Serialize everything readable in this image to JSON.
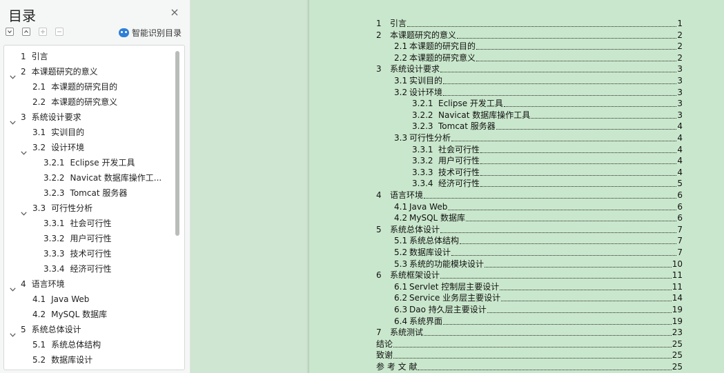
{
  "nav": {
    "title": "目录",
    "close_glyph": "×",
    "smart_toc_label": "智能识别目录",
    "tools": [
      "collapse-all-icon",
      "expand-all-icon",
      "add-heading-icon",
      "remove-heading-icon"
    ],
    "items": [
      {
        "num": "1",
        "title": "引言",
        "level": 0,
        "chevron": "none"
      },
      {
        "num": "2",
        "title": "本课题研究的意义",
        "level": 0,
        "chevron": "down"
      },
      {
        "num": "2.1",
        "title": "本课题的研究目的",
        "level": 1,
        "chevron": "none"
      },
      {
        "num": "2.2",
        "title": "本课题的研究意义",
        "level": 1,
        "chevron": "none"
      },
      {
        "num": "3",
        "title": "系统设计要求",
        "level": 0,
        "chevron": "down"
      },
      {
        "num": "3.1",
        "title": "实训目的",
        "level": 1,
        "chevron": "none"
      },
      {
        "num": "3.2",
        "title": "设计环境",
        "level": 1,
        "chevron": "down"
      },
      {
        "num": "3.2.1",
        "title": "Eclipse 开发工具",
        "level": 2,
        "chevron": "none"
      },
      {
        "num": "3.2.2",
        "title": "Navicat 数据库操作工...",
        "level": 2,
        "chevron": "none"
      },
      {
        "num": "3.2.3",
        "title": "Tomcat 服务器",
        "level": 2,
        "chevron": "none"
      },
      {
        "num": "3.3",
        "title": "可行性分析",
        "level": 1,
        "chevron": "down"
      },
      {
        "num": "3.3.1",
        "title": "社会可行性",
        "level": 2,
        "chevron": "none"
      },
      {
        "num": "3.3.2",
        "title": "用户可行性",
        "level": 2,
        "chevron": "none"
      },
      {
        "num": "3.3.3",
        "title": "技术可行性",
        "level": 2,
        "chevron": "none"
      },
      {
        "num": "3.3.4",
        "title": "经济可行性",
        "level": 2,
        "chevron": "none"
      },
      {
        "num": "4",
        "title": "语言环境",
        "level": 0,
        "chevron": "down"
      },
      {
        "num": "4.1",
        "title": "Java Web",
        "level": 1,
        "chevron": "none"
      },
      {
        "num": "4.2",
        "title": "MySQL 数据库",
        "level": 1,
        "chevron": "none"
      },
      {
        "num": "5",
        "title": "系统总体设计",
        "level": 0,
        "chevron": "down"
      },
      {
        "num": "5.1",
        "title": "系统总体结构",
        "level": 1,
        "chevron": "none"
      },
      {
        "num": "5.2",
        "title": "数据库设计",
        "level": 1,
        "chevron": "none"
      }
    ]
  },
  "document": {
    "toc": [
      {
        "num": "1",
        "title": "引言",
        "page": "1",
        "level": 0
      },
      {
        "num": "2",
        "title": "本课题研究的意义",
        "page": "2",
        "level": 0
      },
      {
        "num": "2.1",
        "title": "本课题的研究目的",
        "page": "2",
        "level": 1
      },
      {
        "num": "2.2",
        "title": "本课题的研究意义",
        "page": "2",
        "level": 1
      },
      {
        "num": "3",
        "title": "系统设计要求",
        "page": "3",
        "level": 0
      },
      {
        "num": "3.1",
        "title": "实训目的",
        "page": "3",
        "level": 1
      },
      {
        "num": "3.2",
        "title": "设计环境",
        "page": "3",
        "level": 1
      },
      {
        "num": "3.2.1",
        "title": "Eclipse 开发工具",
        "page": "3",
        "level": 2
      },
      {
        "num": "3.2.2",
        "title": "Navicat 数据库操作工具",
        "page": "3",
        "level": 2
      },
      {
        "num": "3.2.3",
        "title": "Tomcat 服务器",
        "page": "4",
        "level": 2
      },
      {
        "num": "3.3",
        "title": "可行性分析",
        "page": "4",
        "level": 1
      },
      {
        "num": "3.3.1",
        "title": "社会可行性",
        "page": "4",
        "level": 2
      },
      {
        "num": "3.3.2",
        "title": "用户可行性",
        "page": "4",
        "level": 2
      },
      {
        "num": "3.3.3",
        "title": "技术可行性",
        "page": "4",
        "level": 2
      },
      {
        "num": "3.3.4",
        "title": "经济可行性",
        "page": "5",
        "level": 2
      },
      {
        "num": "4",
        "title": "语言环境",
        "page": "6",
        "level": 0
      },
      {
        "num": "4.1",
        "title": "Java Web",
        "page": "6",
        "level": 1
      },
      {
        "num": "4.2",
        "title": "MySQL 数据库",
        "page": "6",
        "level": 1
      },
      {
        "num": "5",
        "title": "系统总体设计",
        "page": "7",
        "level": 0
      },
      {
        "num": "5.1",
        "title": "系统总体结构",
        "page": "7",
        "level": 1
      },
      {
        "num": "5.2",
        "title": "数据库设计",
        "page": "7",
        "level": 1
      },
      {
        "num": "5.3",
        "title": "系统的功能模块设计",
        "page": "10",
        "level": 1
      },
      {
        "num": "6",
        "title": "系统框架设计",
        "page": "11",
        "level": 0
      },
      {
        "num": "6.1",
        "title": "Servlet 控制层主要设计",
        "page": "11",
        "level": 1
      },
      {
        "num": "6.2",
        "title": "Service 业务层主要设计",
        "page": "14",
        "level": 1
      },
      {
        "num": "6.3",
        "title": "Dao 持久层主要设计",
        "page": "19",
        "level": 1
      },
      {
        "num": "6.4",
        "title": "系统界面",
        "page": "19",
        "level": 1
      },
      {
        "num": "7",
        "title": "系统测试",
        "page": "23",
        "level": 0
      },
      {
        "num": "",
        "title": "结论",
        "page": "25",
        "level": 0
      },
      {
        "num": "",
        "title": "致谢",
        "page": "25",
        "level": 0
      },
      {
        "num": "",
        "title": "参 考 文 献",
        "page": "25",
        "level": 0
      }
    ]
  }
}
